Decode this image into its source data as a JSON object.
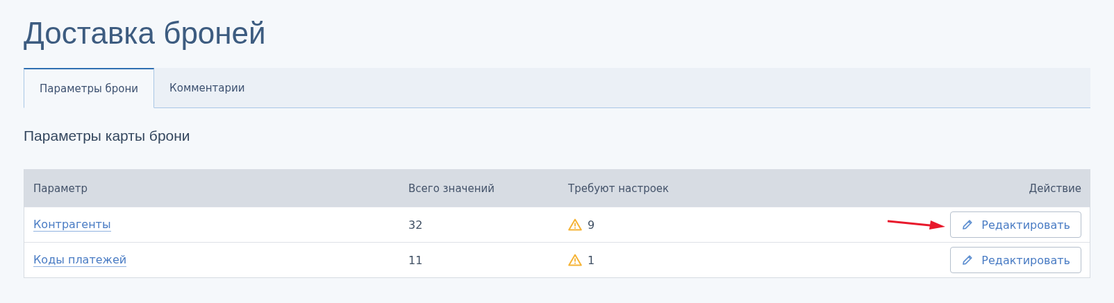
{
  "page": {
    "title": "Доставка броней"
  },
  "tabs": [
    {
      "label": "Параметры брони",
      "selected": true
    },
    {
      "label": "Комментарии",
      "selected": false
    }
  ],
  "section": {
    "title": "Параметры карты брони"
  },
  "table": {
    "columns": [
      "Параметр",
      "Всего значений",
      "Требуют настроек",
      "Действие"
    ],
    "rows": [
      {
        "name": "Контрагенты",
        "total": "32",
        "pending": "9",
        "action": "Редактировать",
        "pointed": true
      },
      {
        "name": "Коды платежей",
        "total": "11",
        "pending": "1",
        "action": "Редактировать",
        "pointed": false
      }
    ]
  }
}
